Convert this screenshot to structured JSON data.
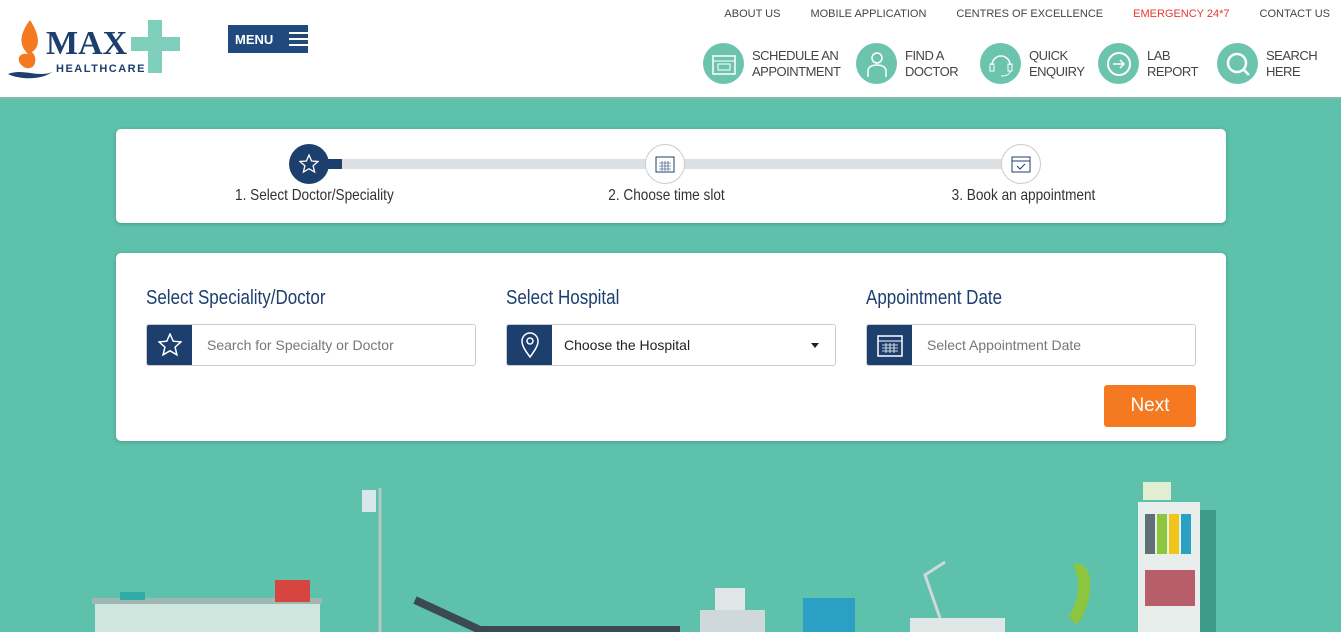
{
  "brand": {
    "name": "MAX",
    "sub": "HEALTHCARE"
  },
  "menu_label": "MENU",
  "top_links": [
    {
      "label": "ABOUT US"
    },
    {
      "label": "MOBILE APPLICATION"
    },
    {
      "label": "CENTRES OF EXCELLENCE"
    },
    {
      "label": "EMERGENCY 24*7"
    },
    {
      "label": "CONTACT US"
    }
  ],
  "quick_links": [
    {
      "label": "SCHEDULE AN\nAPPOINTMENT",
      "icon": "calendar-icon"
    },
    {
      "label": "FIND A\nDOCTOR",
      "icon": "doctor-icon"
    },
    {
      "label": "QUICK\nENQUIRY",
      "icon": "headset-icon"
    },
    {
      "label": "LAB\nREPORT",
      "icon": "report-icon"
    },
    {
      "label": "SEARCH\nHERE",
      "icon": "search-icon"
    }
  ],
  "steps": [
    {
      "label": "1. Select Doctor/Speciality",
      "active": true
    },
    {
      "label": "2. Choose time slot"
    },
    {
      "label": "3. Book an appointment"
    }
  ],
  "form": {
    "speciality": {
      "label": "Select Speciality/Doctor",
      "placeholder": "Search for Specialty or Doctor"
    },
    "hospital": {
      "label": "Select Hospital",
      "value": "Choose the Hospital"
    },
    "date": {
      "label": "Appointment Date",
      "placeholder": "Select Appointment Date"
    },
    "next_label": "Next"
  },
  "colors": {
    "navy": "#1c3f6e",
    "teal": "#5dc1ab",
    "orange": "#f47920",
    "emergency": "#e53935"
  }
}
